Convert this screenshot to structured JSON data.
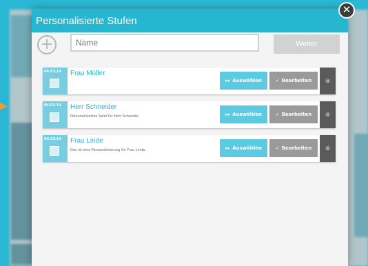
{
  "modal": {
    "title": "Personalisierte Stufen",
    "close_icon": "close-icon",
    "add_icon": "plus-circle-icon",
    "name_placeholder": "Name",
    "next_label": "Weiter"
  },
  "items": [
    {
      "date": "04.03.14",
      "title": "Frau Müller",
      "description": "",
      "select_label": "Auswählen",
      "edit_label": "Bearbeiten"
    },
    {
      "date": "04.03.14",
      "title": "Herr Schneider",
      "description": "Personalisiertes Spiel für Herr Schneide",
      "select_label": "Auswählen",
      "edit_label": "Bearbeiten"
    },
    {
      "date": "04.03.14",
      "title": "Frau Linde",
      "description": "Das ist eine Personalisierung für Frau Linde.",
      "select_label": "Auswählen",
      "edit_label": "Bearbeiten"
    }
  ],
  "colors": {
    "accent": "#27b6d0",
    "select_button": "#5ccbe2",
    "edit_button": "#9a9a9a",
    "delete_button": "#5a5a5a"
  }
}
